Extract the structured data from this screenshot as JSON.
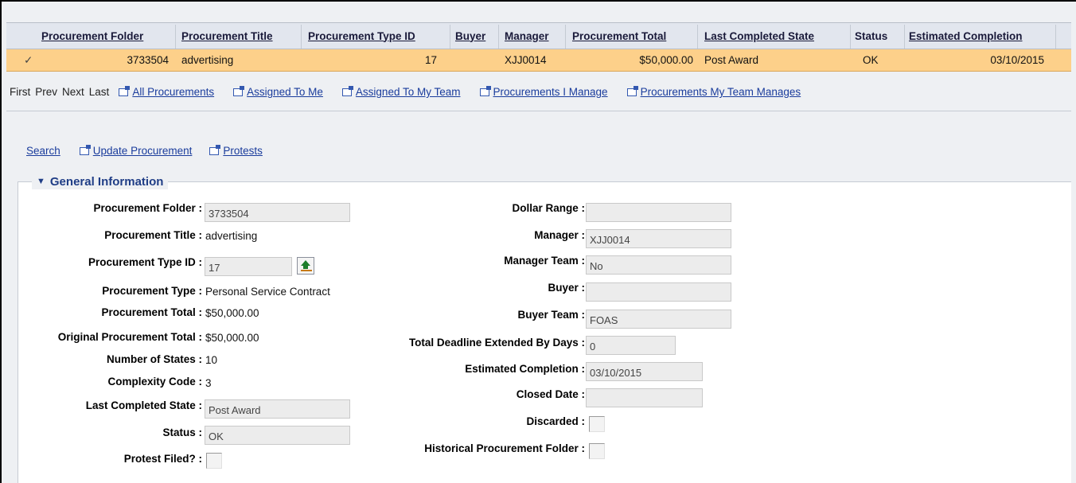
{
  "grid": {
    "columns": [
      "Procurement Folder",
      "Procurement Title",
      "Procurement Type ID",
      "Buyer",
      "Manager",
      "Procurement Total",
      "Last Completed State",
      "Status",
      "Estimated Completion"
    ],
    "row": {
      "check": "✓",
      "folder": "3733504",
      "title": "advertising",
      "type_id": "17",
      "buyer": "",
      "manager": "XJJ0014",
      "total": "$50,000.00",
      "last_state": "Post Award",
      "status": "OK",
      "completion": "03/10/2015"
    },
    "selected_row_color": "#fdd08a"
  },
  "pager": {
    "first": "First",
    "prev": "Prev",
    "next": "Next",
    "last": "Last",
    "links": [
      "All Procurements",
      "Assigned To Me",
      "Assigned To My Team",
      "Procurements I Manage",
      "Procurements My Team Manages"
    ]
  },
  "actions": {
    "search": "Search",
    "update": "Update Procurement",
    "protests": "Protests"
  },
  "general": {
    "legend": "General Information",
    "left": {
      "folder_label": "Procurement Folder :",
      "folder_value": "3733504",
      "title_label": "Procurement Title :",
      "title_value": "advertising",
      "type_id_label": "Procurement Type ID :",
      "type_id_value": "17",
      "type_label": "Procurement Type :",
      "type_value": "Personal Service Contract",
      "total_label": "Procurement Total :",
      "total_value": "$50,000.00",
      "orig_total_label": "Original Procurement Total :",
      "orig_total_value": "$50,000.00",
      "num_states_label": "Number of States :",
      "num_states_value": "10",
      "complexity_label": "Complexity Code :",
      "complexity_value": "3",
      "last_state_label": "Last Completed State :",
      "last_state_value": "Post Award",
      "status_label": "Status :",
      "status_value": "OK",
      "protest_label": "Protest Filed? :"
    },
    "right": {
      "dollar_range_label": "Dollar Range :",
      "dollar_range_value": "",
      "manager_label": "Manager :",
      "manager_value": "XJJ0014",
      "manager_team_label": "Manager Team :",
      "manager_team_value": "No",
      "buyer_label": "Buyer :",
      "buyer_value": "",
      "buyer_team_label": "Buyer Team :",
      "buyer_team_value": "FOAS",
      "deadline_label": "Total Deadline Extended By Days :",
      "deadline_value": "0",
      "est_completion_label": "Estimated Completion :",
      "est_completion_value": "03/10/2015",
      "closed_label": "Closed Date :",
      "closed_value": "",
      "discarded_label": "Discarded :",
      "historical_label": "Historical Procurement Folder :"
    }
  }
}
